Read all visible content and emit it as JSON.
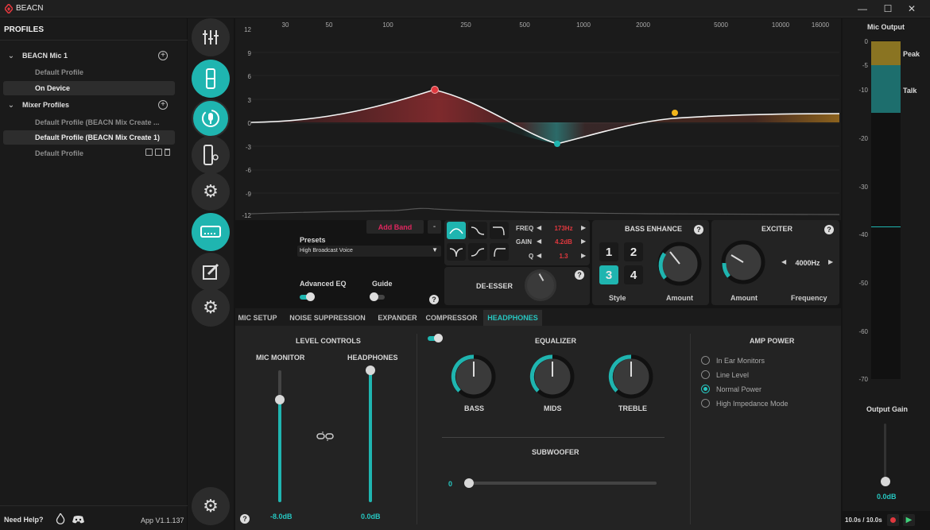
{
  "window": {
    "title": "BEACN",
    "minimize": "—",
    "maximize": "☐",
    "close": "✕"
  },
  "sidebar": {
    "title": "PROFILES",
    "groups": [
      {
        "name": "BEACN Mic 1",
        "items": [
          "Default Profile",
          "On Device"
        ]
      },
      {
        "name": "Mixer Profiles",
        "items": [
          "Default Profile (BEACN Mix Create ...",
          "Default Profile (BEACN Mix Create 1)",
          "Default Profile"
        ]
      }
    ],
    "help": "Need Help?",
    "version": "App V1.1.137"
  },
  "eq_graph": {
    "y_ticks": [
      "12",
      "9",
      "6",
      "3",
      "0",
      "-3",
      "-6",
      "-9",
      "-12"
    ],
    "x_ticks": [
      "30",
      "50",
      "100",
      "250",
      "500",
      "1000",
      "2000",
      "5000",
      "10000",
      "16000"
    ],
    "colors": {
      "band1": "#e0383e",
      "band2": "#1fb5b0",
      "band3": "#f2b51a"
    }
  },
  "controls": {
    "add_band": "Add Band",
    "minus": "-",
    "presets_label": "Presets",
    "presets_value": "High Broadcast Voice",
    "advanced_eq": "Advanced EQ",
    "guide": "Guide",
    "freq_label": "FREQ",
    "freq_value": "173Hz",
    "gain_label": "GAIN",
    "gain_value": "4.2dB",
    "q_label": "Q",
    "q_value": "1.3",
    "de_esser": "DE-ESSER",
    "bass_enhance": "BASS ENHANCE",
    "style_buttons": [
      "1",
      "2",
      "3",
      "4"
    ],
    "style_label": "Style",
    "amount_label": "Amount",
    "exciter": "EXCITER",
    "exciter_freq": "4000Hz",
    "frequency_label": "Frequency"
  },
  "tabs": [
    "MIC SETUP",
    "NOISE SUPPRESSION",
    "EXPANDER",
    "COMPRESSOR",
    "HEADPHONES"
  ],
  "headphones": {
    "level_controls": "LEVEL CONTROLS",
    "mic_monitor": "MIC MONITOR",
    "headphones_label": "HEADPHONES",
    "mic_monitor_value": "-8.0dB",
    "headphones_value": "0.0dB",
    "mic_monitor_level": 0.78,
    "headphones_level": 1.0,
    "equalizer": "EQUALIZER",
    "bass": "BASS",
    "mids": "MIDS",
    "treble": "TREBLE",
    "subwoofer": "SUBWOOFER",
    "subwoofer_value": "0",
    "amp_power": "AMP POWER",
    "amp_options": [
      "In Ear Monitors",
      "Line Level",
      "Normal Power",
      "High Impedance Mode"
    ],
    "amp_selected": "Normal Power"
  },
  "meter": {
    "title": "Mic Output",
    "ticks": [
      "0",
      "-5",
      "-10",
      "-20",
      "-30",
      "-40",
      "-50",
      "-60",
      "-70"
    ],
    "peak": "Peak",
    "talk": "Talk",
    "output_gain": "Output Gain",
    "output_gain_value": "0.0dB",
    "time": "10.0s / 10.0s",
    "colors": {
      "peak": "#8a7422",
      "talk": "#1d6e6d"
    }
  }
}
